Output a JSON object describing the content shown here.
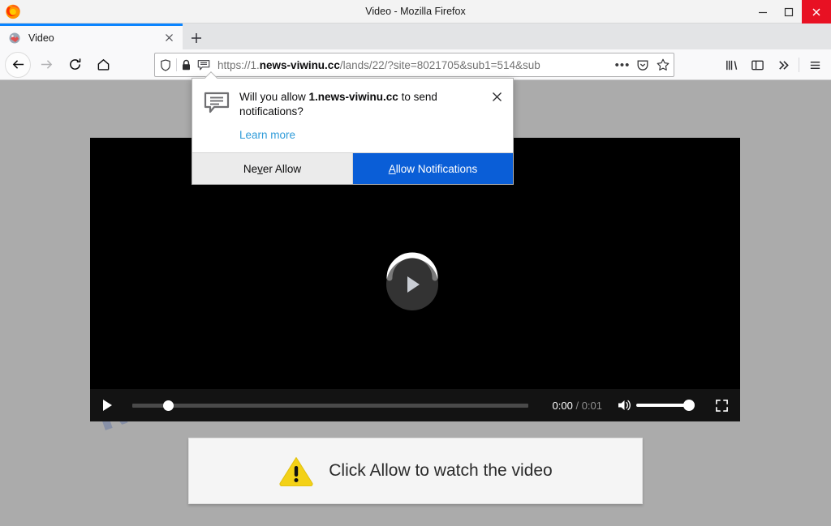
{
  "window": {
    "title": "Video - Mozilla Firefox",
    "minimize_label": "Minimize",
    "maximize_label": "Maximize",
    "close_label": "Close",
    "close_color": "#e81123"
  },
  "tabs": {
    "active": {
      "label": "Video",
      "favicon": "firefox-favicon",
      "close_label": "Close tab"
    },
    "new_tab_label": "New tab",
    "active_indicator_color": "#0a84ff"
  },
  "toolbar": {
    "back_label": "Go back one page",
    "forward_label": "Go forward one page",
    "reload_label": "Reload current page",
    "home_label": "Home",
    "library_label": "Library",
    "sidebar_label": "Sidebar",
    "overflow_label": "More tools",
    "menu_label": "Open menu"
  },
  "urlbar": {
    "shield_icon": "shield-icon",
    "lock_icon": "padlock-icon",
    "notification_icon": "notification-bubble-icon",
    "scheme": "https://",
    "host_prefix": "1.",
    "host_bold": "news-viwinu.cc",
    "path": "/lands/22/?site=8021705&sub1=514&sub",
    "full_text": "https://1.news-viwinu.cc/lands/22/?site=8021705&sub1=514&sub",
    "page_actions_label": "Page actions",
    "pocket_label": "Save to Pocket",
    "bookmark_label": "Bookmark this page"
  },
  "popup": {
    "message_prefix": "Will you allow ",
    "message_host": "1.news-viwinu.cc",
    "message_suffix": " to send notifications?",
    "learn_more": "Learn more",
    "close_label": "Close",
    "never_allow_pre": "Ne",
    "never_allow_key": "v",
    "never_allow_post": "er Allow",
    "allow_key": "A",
    "allow_post": "llow Notifications",
    "allow_bg": "#0a5ed7"
  },
  "player": {
    "play_label": "Play",
    "big_play_label": "Play video",
    "current_time": "0:00",
    "separator": " / ",
    "duration": "0:01",
    "mute_label": "Mute",
    "volume_label": "Volume",
    "fullscreen_label": "Full screen",
    "progress_percent": 0,
    "volume_percent": 100
  },
  "banner": {
    "icon": "warning-triangle-icon",
    "icon_color": "#f3d117",
    "text": "Click Allow to watch the video"
  },
  "page": {
    "watermark": "MYANTISPYWARE.COM",
    "background_color": "#ababab"
  }
}
